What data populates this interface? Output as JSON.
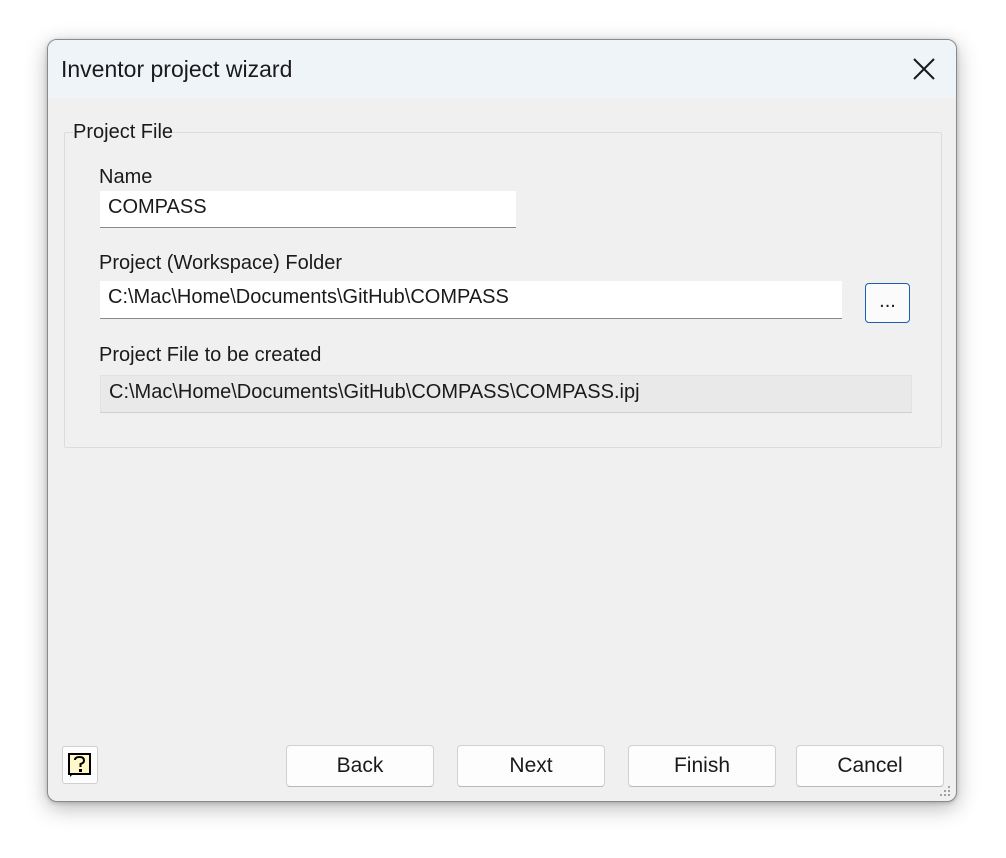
{
  "window": {
    "title": "Inventor project wizard",
    "close_icon": "close-icon"
  },
  "project_file_group": {
    "legend": "Project File",
    "name_label": "Name",
    "name_value": "COMPASS",
    "folder_label": "Project (Workspace) Folder",
    "folder_value": "C:\\Mac\\Home\\Documents\\GitHub\\COMPASS",
    "browse_label": "...",
    "created_label": "Project File to be created",
    "created_value": "C:\\Mac\\Home\\Documents\\GitHub\\COMPASS\\COMPASS.ipj"
  },
  "footer": {
    "help_icon": "help-icon",
    "back_label": "Back",
    "next_label": "Next",
    "finish_label": "Finish",
    "cancel_label": "Cancel"
  },
  "colors": {
    "dialog_bg": "#f0f0f0",
    "titlebar_bg": "#eff4f9",
    "accent_border": "#1a5fb4"
  }
}
